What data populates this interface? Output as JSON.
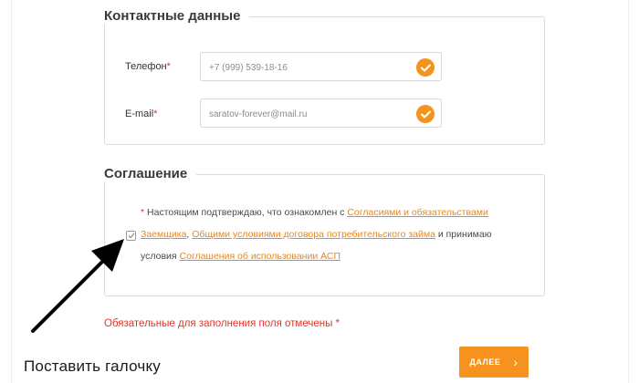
{
  "contacts": {
    "legend": "Контактные данные",
    "phone": {
      "label": "Телефон",
      "required_mark": "*",
      "value": "+7 (999) 539-18-16"
    },
    "email": {
      "label": "E-mail",
      "required_mark": "*",
      "value": "saratov-forever@mail.ru"
    }
  },
  "agreement": {
    "legend": "Соглашение",
    "required_mark": "*",
    "line1_text": "Настоящим подтверждаю, что ознакомлен с",
    "link_consents": "Согласиями и обязательствами",
    "link_borrower": "Заемщика",
    "comma": ",",
    "link_general_terms": "Общими условиями договора потребительского займа",
    "line2_tail": "и принимаю",
    "line3_prefix": "условия",
    "link_asp": "Соглашения об использовании АСП",
    "checkbox_checked": true
  },
  "required_note": "Обязательные для заполнения поля отмечены *",
  "caption": "Поставить галочку",
  "next_button": {
    "label": "ДАЛЕЕ",
    "chevron": "›"
  },
  "colors": {
    "accent": "#f5931e",
    "required": "#e0352b",
    "link": "#e8871a"
  }
}
